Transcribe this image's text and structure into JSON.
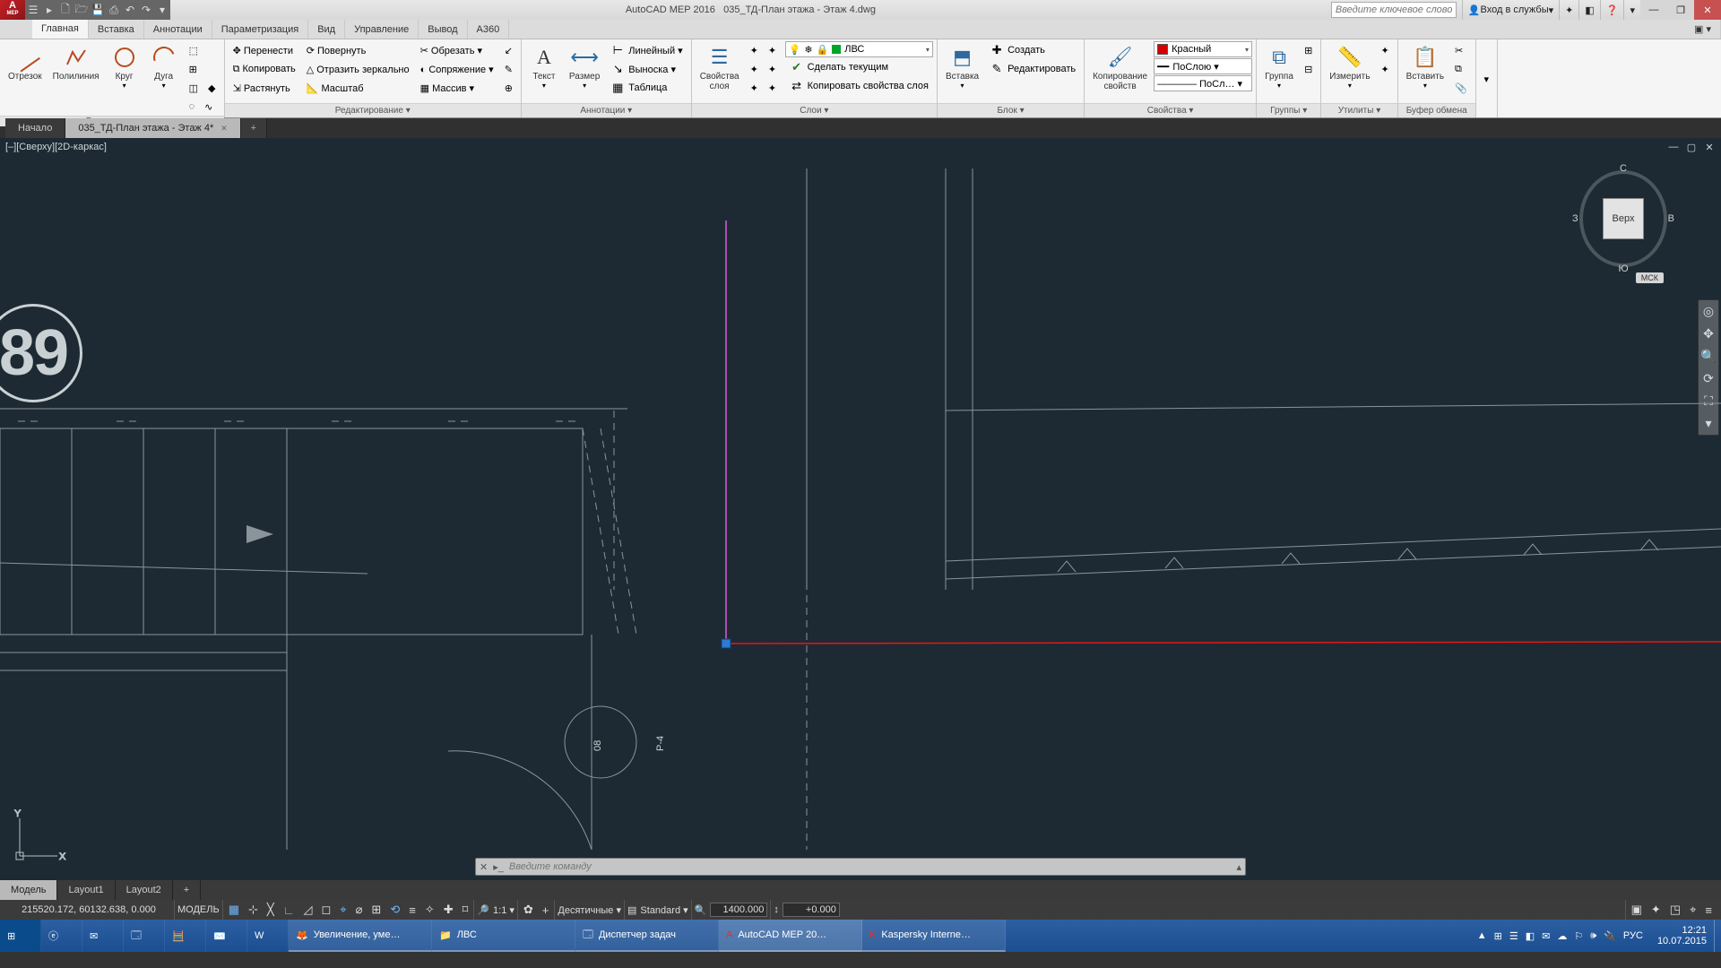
{
  "title": {
    "app": "AutoCAD MEP 2016",
    "doc": "035_ТД-План этажа - Этаж 4.dwg"
  },
  "qat": [
    "☰",
    "▸",
    "🗋",
    "🗁",
    "💾",
    "⎙",
    "↶",
    "↷"
  ],
  "search": {
    "placeholder": "Введите ключевое слово/фразу"
  },
  "titleRight": {
    "signin": "Вход в службы",
    "icons": [
      "✦",
      "◧",
      "❓",
      "▾"
    ]
  },
  "menutabs": [
    "Главная",
    "Вставка",
    "Аннотации",
    "Параметризация",
    "Вид",
    "Управление",
    "Вывод",
    "A360"
  ],
  "activeMenuTab": 0,
  "ribbon": {
    "draw": {
      "title": "Рисование ▾",
      "big": [
        {
          "k": "line",
          "lbl": "Отрезок"
        },
        {
          "k": "pline",
          "lbl": "Полилиния"
        },
        {
          "k": "circle",
          "lbl": "Круг"
        },
        {
          "k": "arc",
          "lbl": "Дуга"
        }
      ],
      "grid": [
        "⬚",
        "⊞",
        "◫",
        "◆",
        "◌",
        "∿",
        "／",
        "⦿",
        "☁"
      ]
    },
    "modify": {
      "title": "Редактирование ▾",
      "rows": [
        [
          "✥ Перенести",
          "⟳ Повернуть",
          "✂ Обрезать ▾",
          "↙"
        ],
        [
          "⧉ Копировать",
          "△ Отразить зеркально",
          "◐ Сопряжение ▾",
          "✎"
        ],
        [
          "⇲ Растянуть",
          "📐 Масштаб",
          "▦ Массив ▾",
          "⊕"
        ]
      ],
      "ext": [
        "✎",
        "✂",
        "⌀"
      ]
    },
    "annot": {
      "title": "Аннотации ▾",
      "big": [
        {
          "k": "text",
          "lbl": "Текст"
        },
        {
          "k": "dim",
          "lbl": "Размер"
        }
      ],
      "rows": [
        "Линейный ▾",
        "Выноска ▾",
        "Таблица"
      ]
    },
    "layers": {
      "title": "Слои ▾",
      "big": {
        "lbl": "Свойства\nслоя"
      },
      "combo": {
        "icons": "💡❄🔒",
        "name": "ЛВС"
      },
      "rows": [
        "Сделать текущим",
        "Копировать свойства слоя"
      ],
      "grid": [
        "✦",
        "✦",
        "✦",
        "✦",
        "✦",
        "✦",
        "✦",
        "✦",
        "✦"
      ]
    },
    "block": {
      "title": "Блок ▾",
      "big": {
        "lbl": "Вставка"
      },
      "rows": [
        "Создать",
        "Редактировать"
      ]
    },
    "props": {
      "title": "Копирование\nсвойств",
      "panel": "Свойства ▾",
      "combo1": {
        "sw": "#d50000",
        "name": "Красный"
      },
      "combo2": {
        "name": "ПоСлою ▾"
      },
      "combo3": {
        "name": "———— ПоСл… ▾"
      }
    },
    "groups": {
      "title": "Группы ▾",
      "big": {
        "lbl": "Группа"
      }
    },
    "utils": {
      "title": "Утилиты ▾",
      "big": {
        "lbl": "Измерить"
      }
    },
    "clip": {
      "title": "Буфер обмена",
      "big": {
        "lbl": "Вставить"
      }
    }
  },
  "doctabs": [
    {
      "t": "Начало"
    },
    {
      "t": "035_ТД-План этажа - Этаж 4*",
      "active": true,
      "close": true
    },
    {
      "t": "+",
      "add": true
    }
  ],
  "viewport": {
    "label": "[–][Сверху][2D-каркас]",
    "bubble": "89",
    "cubeFace": "Верх",
    "cubeN": "С",
    "cubeS": "Ю",
    "cubeE": "В",
    "cubeW": "З",
    "wcs": "МСК"
  },
  "cmd": {
    "placeholder": "Введите команду"
  },
  "layouts": [
    {
      "t": "Модель",
      "active": true
    },
    {
      "t": "Layout1"
    },
    {
      "t": "Layout2"
    },
    {
      "t": "+",
      "add": true
    }
  ],
  "status": {
    "coords": "215520.172, 60132.638, 0.000",
    "space": "МОДЕЛЬ",
    "toggles": [
      "▦",
      "⊹",
      "╳",
      "∟",
      "◿",
      "◻",
      "⌖",
      "⌀",
      "⊞",
      "⟲",
      "≡",
      "✧",
      "✚",
      "⌑"
    ],
    "anno": "1:1 ▾",
    "gear": "✿",
    "plus": "+",
    "units": "Десятичные ▾",
    "style": "Standard ▾",
    "zoom": "1400.000",
    "elev": "+0.000",
    "tail": [
      "▣",
      "✦",
      "◳",
      "⌖",
      "≡"
    ]
  },
  "taskbar": {
    "pinned": [
      "⊞",
      "ⓔ",
      "✉",
      "🗔",
      "🧮",
      "✉️",
      "W"
    ],
    "apps": [
      {
        "ico": "🦊",
        "t": "Увеличение, уме…"
      },
      {
        "ico": "📁",
        "t": "ЛВС"
      },
      {
        "ico": "🗔",
        "t": "Диспетчер задач"
      },
      {
        "ico": "A",
        "t": "AutoCAD MEP 20…",
        "active": true
      },
      {
        "ico": "K",
        "t": "Kaspersky Interne…"
      }
    ],
    "tray": [
      "▲",
      "⊞",
      "☰",
      "◧",
      "✉",
      "☁",
      "⚐",
      "🕪",
      "🔌"
    ],
    "lang": "РУС",
    "time": "12:21",
    "date": "10.07.2015"
  }
}
